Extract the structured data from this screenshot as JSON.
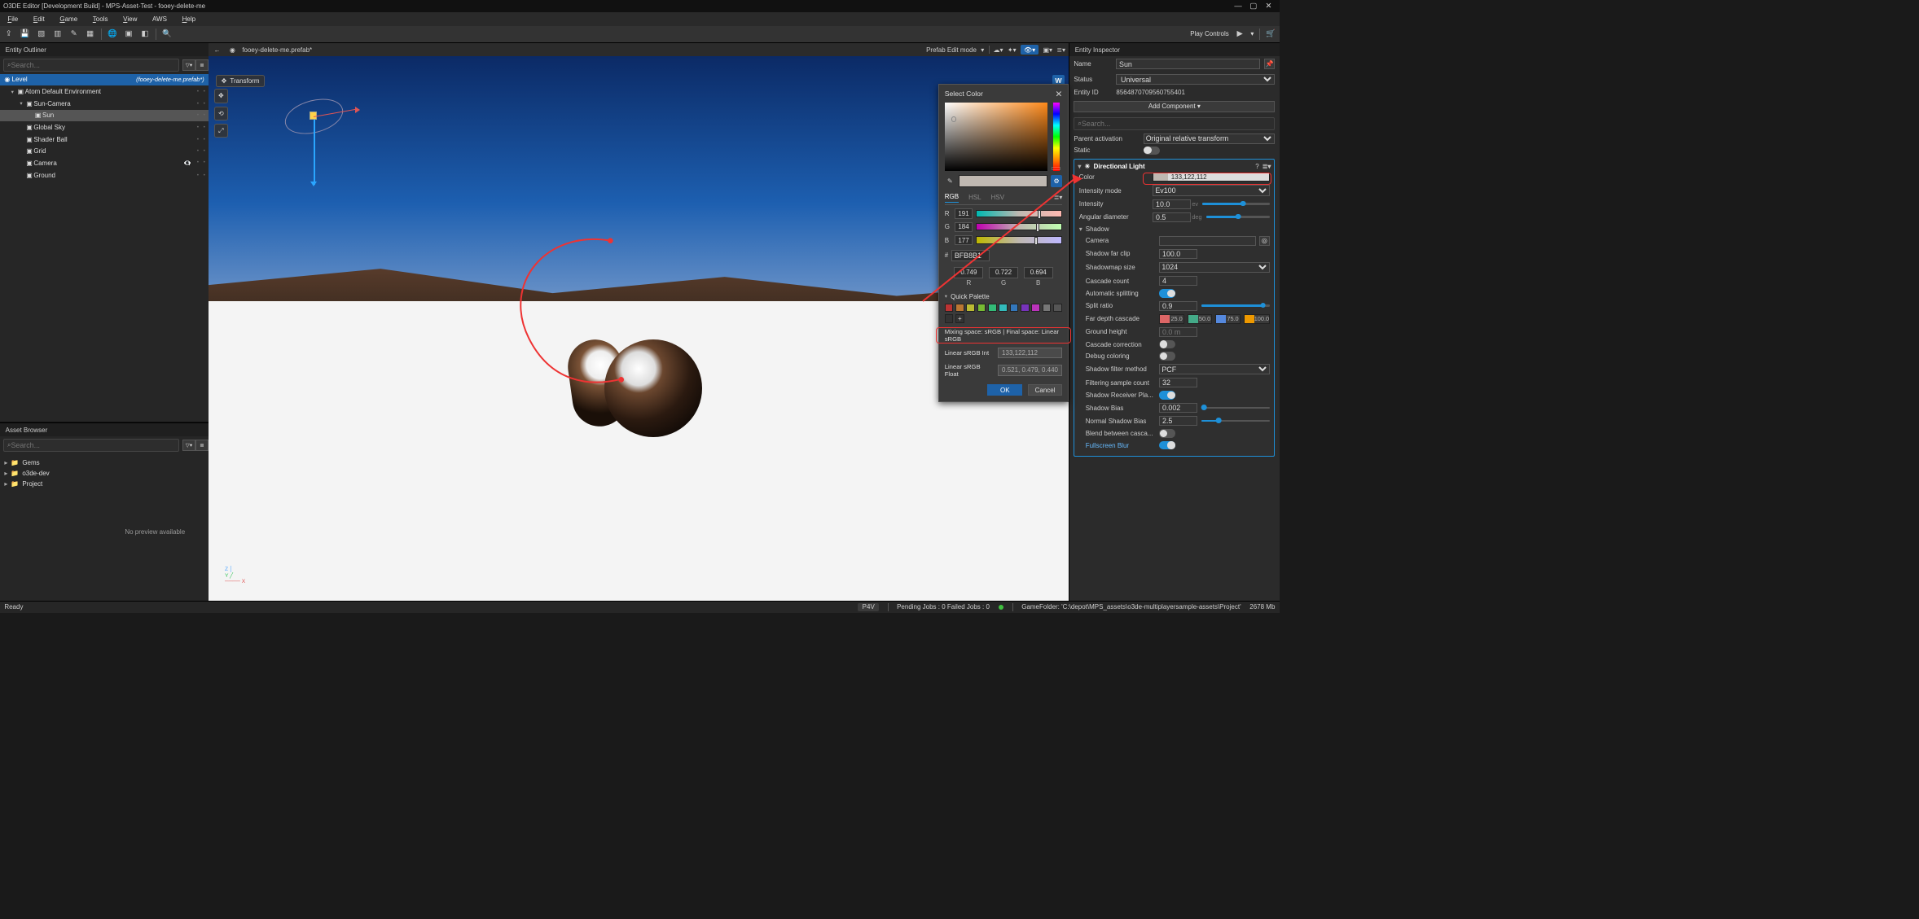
{
  "window": {
    "title": "O3DE Editor [Development Build] - MPS-Asset-Test - fooey-delete-me"
  },
  "menu": {
    "file": "File",
    "edit": "Edit",
    "game": "Game",
    "tools": "Tools",
    "view": "View",
    "aws": "AWS",
    "help": "Help"
  },
  "toolbar": {
    "play_controls": "Play Controls"
  },
  "outliner": {
    "title": "Entity Outliner",
    "search_placeholder": "Search...",
    "level_label": "Level",
    "level_prefab": "(fooey-delete-me.prefab*)",
    "items": [
      {
        "label": "Atom Default Environment",
        "indent": 1,
        "caret": true
      },
      {
        "label": "Sun-Camera",
        "indent": 2,
        "caret": true
      },
      {
        "label": "Sun",
        "indent": 3,
        "selected": true
      },
      {
        "label": "Global Sky",
        "indent": 2
      },
      {
        "label": "Shader Ball",
        "indent": 2
      },
      {
        "label": "Grid",
        "indent": 2
      },
      {
        "label": "Camera",
        "indent": 2,
        "hidden": true
      },
      {
        "label": "Ground",
        "indent": 2
      }
    ]
  },
  "assetbrowser": {
    "title": "Asset Browser",
    "search_placeholder": "Search...",
    "items": [
      {
        "label": "Gems"
      },
      {
        "label": "o3de-dev"
      },
      {
        "label": "Project"
      }
    ],
    "no_preview": "No preview available"
  },
  "viewport": {
    "tab": "fooey-delete-me.prefab*",
    "transform_label": "Transform",
    "mode_label": "Prefab Edit mode",
    "w_badge": "W"
  },
  "colordlg": {
    "title": "Select Color",
    "tab_rgb": "RGB",
    "tab_hsl": "HSL",
    "tab_hsv": "HSV",
    "r_label": "R",
    "r_val": "191",
    "g_label": "G",
    "g_val": "184",
    "b_label": "B",
    "b_val": "177",
    "hex": "BFB8B1",
    "fr": "0.749",
    "fg": "0.722",
    "fb": "0.694",
    "fr_lab": "R",
    "fg_lab": "G",
    "fb_lab": "B",
    "qp_title": "Quick Palette",
    "mixing": "Mixing space: sRGB  |  Final space: Linear sRGB",
    "lin_int_label": "Linear sRGB Int",
    "lin_int_val": "133,122,112",
    "lin_float_label": "Linear sRGB Float",
    "lin_float_val": "0.521, 0.479, 0.440",
    "ok": "OK",
    "cancel": "Cancel",
    "palette": [
      "#b33",
      "#b73",
      "#bb3",
      "#7b3",
      "#3b7",
      "#3bb",
      "#37b",
      "#73b",
      "#b3b",
      "#777",
      "#555",
      "#333"
    ]
  },
  "inspector": {
    "title": "Entity Inspector",
    "name_label": "Name",
    "name_value": "Sun",
    "status_label": "Status",
    "status_value": "Universal",
    "entityid_label": "Entity ID",
    "entityid_value": "8564870709560755401",
    "add_component": "Add Component ▾",
    "search_placeholder": "Search...",
    "parent_label": "Parent activation",
    "parent_value": "Original relative transform",
    "static_label": "Static",
    "component": {
      "title": "Directional Light",
      "color_label": "Color",
      "color_text": "133,122,112",
      "intmode_label": "Intensity mode",
      "intmode_value": "Ev100",
      "intensity_label": "Intensity",
      "intensity_value": "10.0",
      "intensity_unit": "ev",
      "angdia_label": "Angular diameter",
      "angdia_value": "0.5",
      "angdia_unit": "deg",
      "shadow_label": "Shadow",
      "camera_label": "Camera",
      "farclip_label": "Shadow far clip",
      "farclip_value": "100.0",
      "mapsize_label": "Shadowmap size",
      "mapsize_value": "1024",
      "cascade_label": "Cascade count",
      "cascade_value": "4",
      "autosplit_label": "Automatic splitting",
      "splitratio_label": "Split ratio",
      "splitratio_value": "0.9",
      "fardepth_label": "Far depth cascade",
      "fardepth": [
        {
          "c": "#d66",
          "t": "25.0"
        },
        {
          "c": "#4a8",
          "t": "50.0"
        },
        {
          "c": "#58d",
          "t": "75.0"
        },
        {
          "c": "#e90",
          "t": "100.0"
        }
      ],
      "ground_label": "Ground height",
      "ground_value": "0.0 m",
      "casccorr_label": "Cascade correction",
      "debugcol_label": "Debug coloring",
      "filtermethod_label": "Shadow filter method",
      "filtermethod_value": "PCF",
      "sampcount_label": "Filtering sample count",
      "sampcount_value": "32",
      "receiver_label": "Shadow Receiver Pla...",
      "shadowbias_label": "Shadow Bias",
      "shadowbias_value": "0.002",
      "normbias_label": "Normal Shadow Bias",
      "normbias_value": "2.5",
      "blend_label": "Blend between casca...",
      "fsblur_label": "Fullscreen Blur"
    }
  },
  "status": {
    "ready": "Ready",
    "p4v": "P4V",
    "pending": "Pending Jobs : 0  Failed Jobs : 0",
    "folder": "GameFolder: 'C:\\depot\\MPS_assets\\o3de-multiplayersample-assets\\Project'",
    "mem": "2678 Mb"
  }
}
